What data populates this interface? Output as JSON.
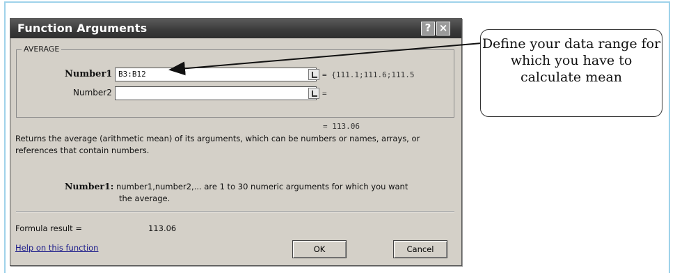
{
  "dialog": {
    "title": "Function Arguments",
    "help_button": "?",
    "close_button": "×",
    "function_name": "AVERAGE",
    "arguments": [
      {
        "label": "Number1",
        "value": "B3:B12",
        "evaluated": "= {111.1;111.6;111.5"
      },
      {
        "label": "Number2",
        "value": "",
        "evaluated": "="
      }
    ],
    "result_preview": "= 113.06",
    "description": "Returns the average (arithmetic mean) of its arguments, which can be numbers or names, arrays, or references that contain numbers.",
    "arg_help_name": "Number1:",
    "arg_help_text": "number1,number2,... are 1 to 30 numeric arguments for which you want",
    "arg_help_cont": "the average.",
    "formula_result_label": "Formula result =",
    "formula_result_value": "113.06",
    "help_link": "Help on this function",
    "ok_label": "OK",
    "cancel_label": "Cancel"
  },
  "callout": {
    "text": "Define your data range for which you have to calculate mean"
  },
  "colors": {
    "frame": "#9fd2ea",
    "dialog_bg": "#d4d0c8",
    "titlebar": "#3a3a3a"
  }
}
